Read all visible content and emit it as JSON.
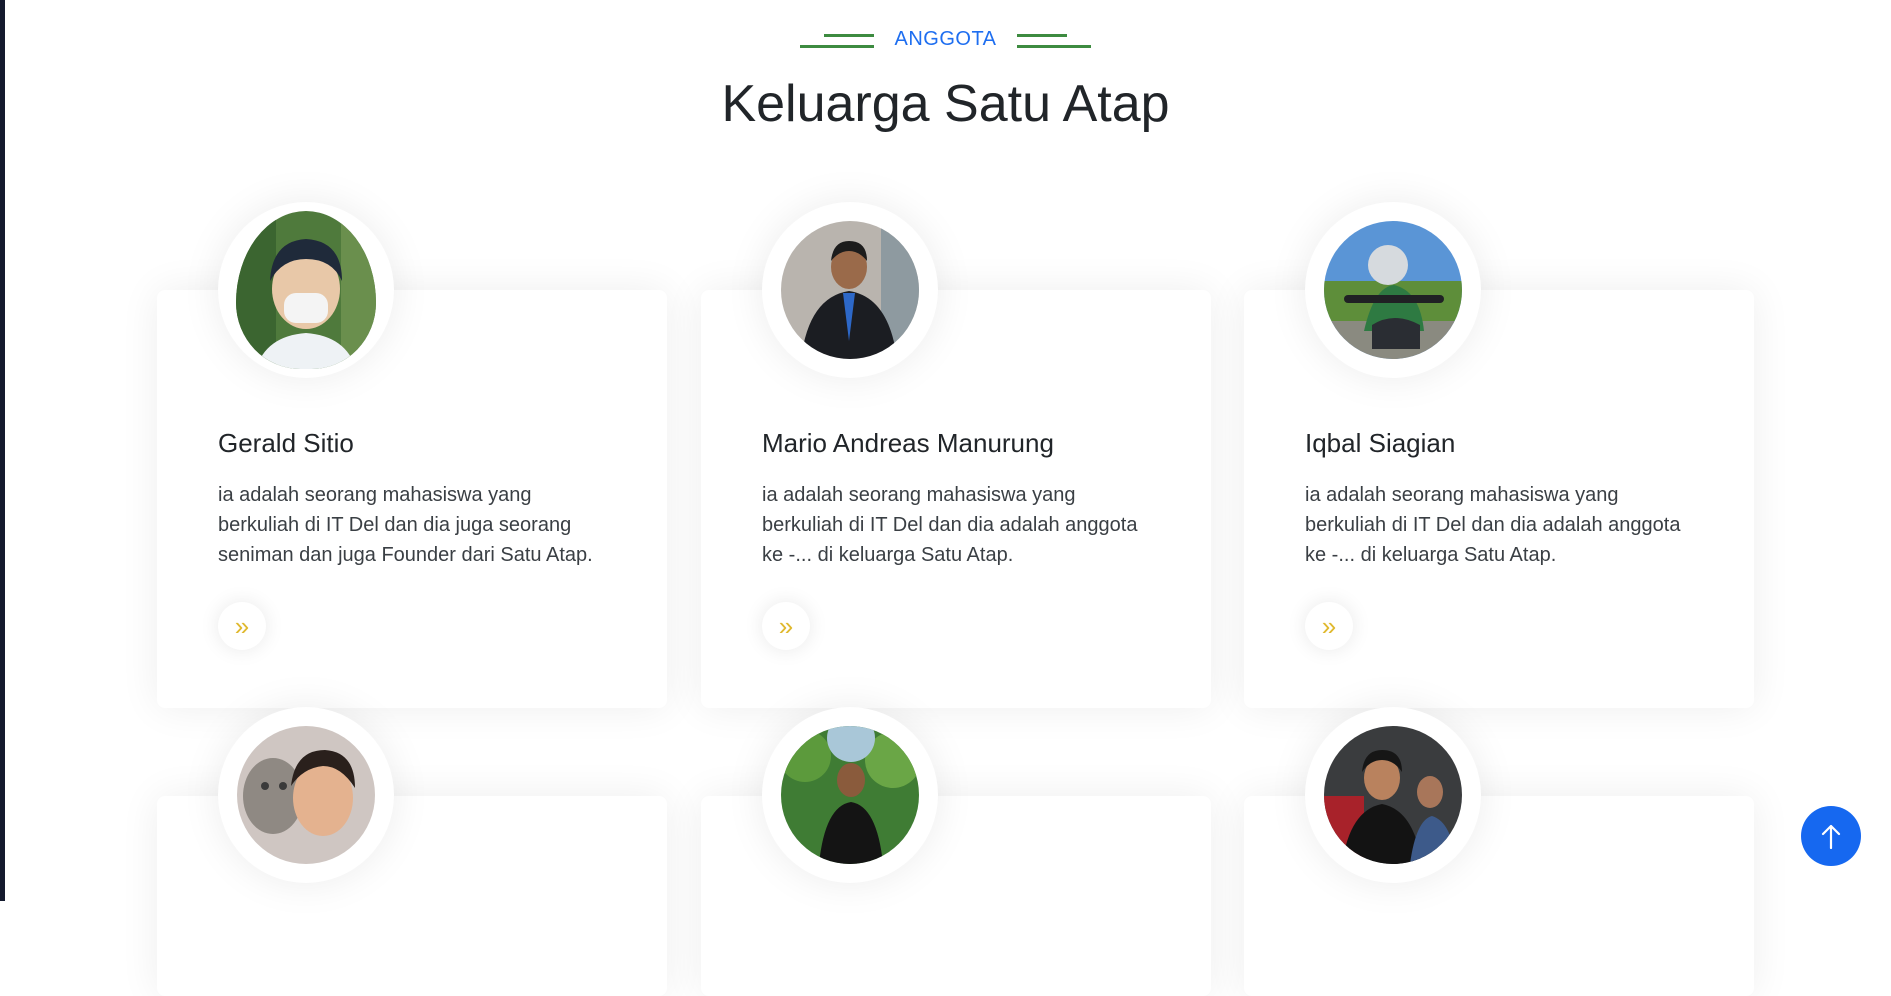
{
  "section": {
    "eyebrow": "ANGGOTA",
    "title": "Keluarga Satu Atap"
  },
  "members": [
    {
      "name": "Gerald Sitio",
      "description": "ia adalah seorang mahasiswa yang berkuliah di IT Del dan dia juga seorang seniman dan juga Founder dari Satu Atap."
    },
    {
      "name": "Mario Andreas Manurung",
      "description": "ia adalah seorang mahasiswa yang berkuliah di IT Del dan dia adalah anggota ke -... di keluarga Satu Atap."
    },
    {
      "name": "Iqbal Siagian",
      "description": "ia adalah seorang mahasiswa yang berkuliah di IT Del dan dia adalah anggota ke -... di keluarga Satu Atap."
    }
  ],
  "icons": {
    "read_more": "double-chevron-right-icon",
    "back_to_top": "arrow-up-icon"
  },
  "colors": {
    "accent_blue": "#1e6ef0",
    "decor_green": "#3d8b40",
    "arrow_gold": "#e0b92f",
    "back_to_top_bg": "#1668f0"
  }
}
